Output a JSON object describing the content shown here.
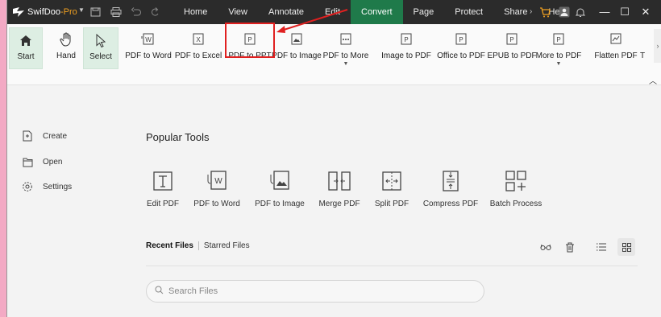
{
  "app": {
    "name": "SwifDoo",
    "edition": "-Pro"
  },
  "menu": [
    {
      "label": "Home",
      "active": false
    },
    {
      "label": "View",
      "active": false
    },
    {
      "label": "Annotate",
      "active": false
    },
    {
      "label": "Edit",
      "active": false
    },
    {
      "label": "Convert",
      "active": true
    },
    {
      "label": "Page",
      "active": false
    },
    {
      "label": "Protect",
      "active": false
    },
    {
      "label": "Share",
      "active": false
    },
    {
      "label": "Help",
      "active": false
    }
  ],
  "ribbon": {
    "start": "Start",
    "hand": "Hand",
    "select": "Select",
    "pdf_to_word": "PDF to Word",
    "pdf_to_excel": "PDF to Excel",
    "pdf_to_ppt": "PDF to PPT",
    "pdf_to_image": "PDF to Image",
    "pdf_to_more": "PDF to More",
    "image_to_pdf": "Image to PDF",
    "office_to_pdf": "Office to PDF",
    "epub_to_pdf": "EPUB to PDF",
    "more_to_pdf": "More to PDF",
    "flatten_pdf": "Flatten PDF",
    "overflow": "T"
  },
  "sidebar": {
    "create": "Create",
    "open": "Open",
    "settings": "Settings"
  },
  "main": {
    "title": "Popular Tools",
    "tools": [
      {
        "label": "Edit PDF",
        "icon": "edit-pdf-icon"
      },
      {
        "label": "PDF to Word",
        "icon": "pdf-to-word-icon"
      },
      {
        "label": "PDF to Image",
        "icon": "pdf-to-image-icon"
      },
      {
        "label": "Merge PDF",
        "icon": "merge-pdf-icon"
      },
      {
        "label": "Split PDF",
        "icon": "split-pdf-icon"
      },
      {
        "label": "Compress PDF",
        "icon": "compress-pdf-icon"
      },
      {
        "label": "Batch Process",
        "icon": "batch-process-icon"
      }
    ],
    "tabs": {
      "recent": "Recent Files",
      "starred": "Starred Files"
    },
    "search_placeholder": "Search Files"
  },
  "colors": {
    "accent": "#1f7a4a",
    "highlight": "#e02020",
    "titlebar": "#2b2b2b"
  }
}
